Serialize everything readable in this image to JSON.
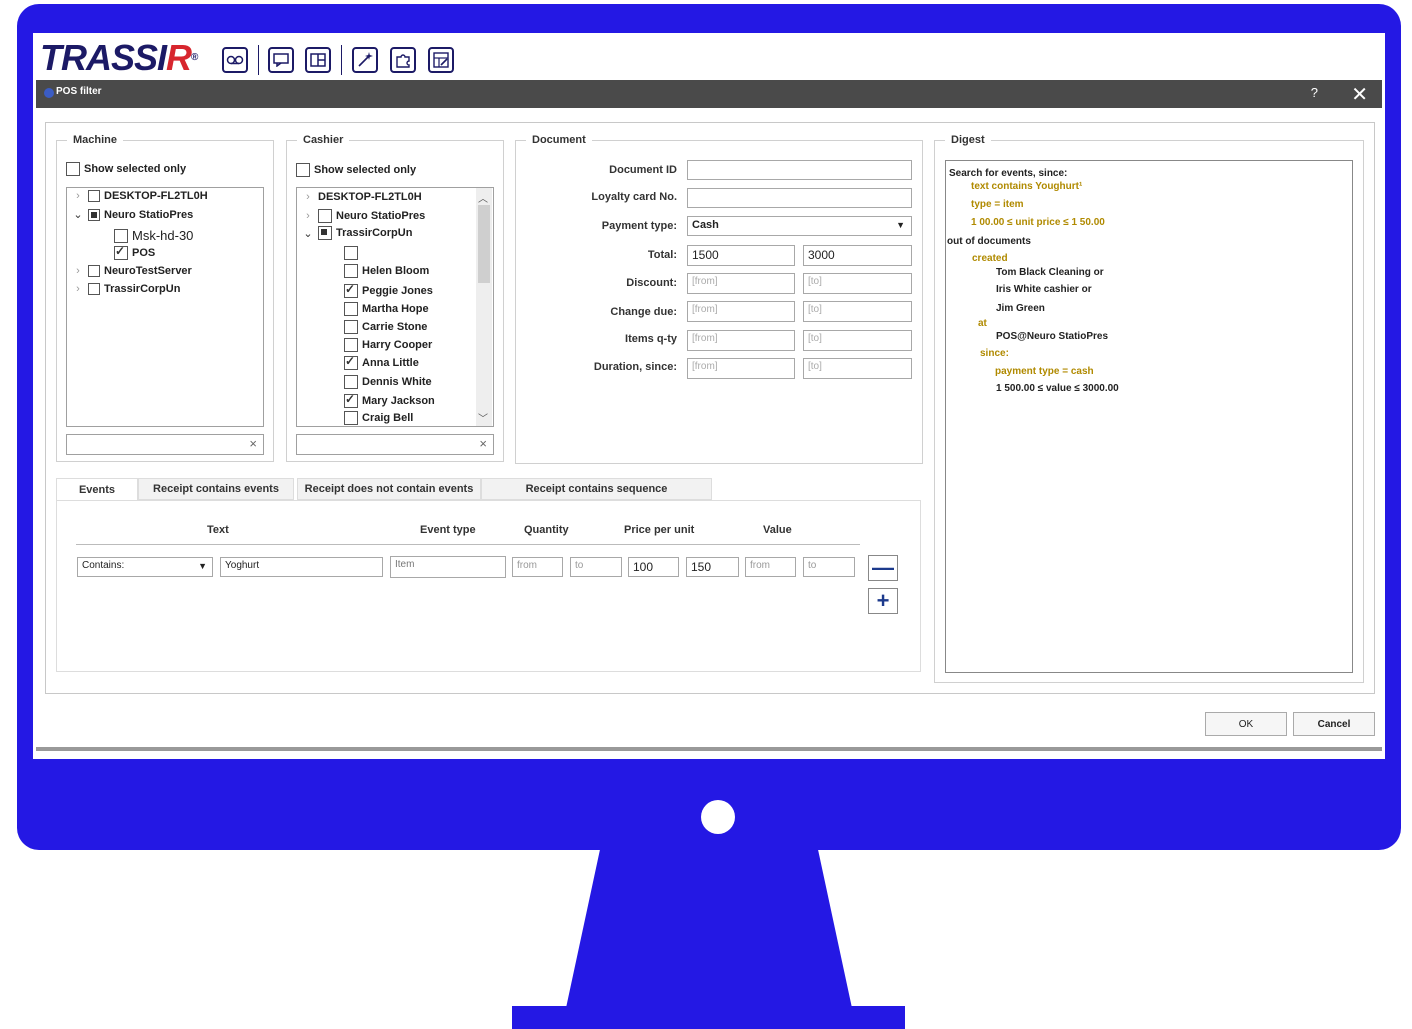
{
  "app": {
    "logo_main": "TRASSI",
    "logo_r": "R",
    "logo_mark": "®",
    "window_title": "POS filter",
    "help": "?",
    "close": "✕",
    "toolbar_icons": [
      "voicemail-icon",
      "chat-icon",
      "layout-icon",
      "magic-wand-icon",
      "puzzle-icon",
      "image-edit-icon"
    ]
  },
  "machine": {
    "title": "Machine",
    "show_selected_label": "Show selected only",
    "items": [
      {
        "label": "DESKTOP-FL2TL0H",
        "state": "unchecked",
        "expanded": false
      },
      {
        "label": "Neuro StatioPres",
        "state": "partial",
        "expanded": true
      },
      {
        "label": "Msk-hd-30",
        "state": "unchecked"
      },
      {
        "label": "POS",
        "state": "checked"
      },
      {
        "label": "NeuroTestServer",
        "state": "unchecked",
        "expanded": false
      },
      {
        "label": "TrassirCorpUn",
        "state": "unchecked",
        "expanded": false
      }
    ],
    "search_value": ""
  },
  "cashier": {
    "title": "Cashier",
    "show_selected_label": "Show selected only",
    "items": [
      {
        "label": "DESKTOP-FL2TL0H"
      },
      {
        "label": "Neuro StatioPres",
        "state": "unchecked"
      },
      {
        "label": "TrassirCorpUn",
        "state": "partial"
      },
      {
        "label": "",
        "state": "unchecked"
      },
      {
        "label": "Helen Bloom",
        "state": "unchecked"
      },
      {
        "label": "Peggie Jones",
        "state": "checked"
      },
      {
        "label": "Martha Hope",
        "state": "unchecked"
      },
      {
        "label": "Carrie Stone",
        "state": "unchecked"
      },
      {
        "label": "Harry Cooper",
        "state": "unchecked"
      },
      {
        "label": "Anna Little",
        "state": "checked"
      },
      {
        "label": "Dennis White",
        "state": "unchecked"
      },
      {
        "label": "Mary Jackson",
        "state": "checked"
      },
      {
        "label": "Craig Bell",
        "state": "unchecked"
      }
    ],
    "search_value": ""
  },
  "document": {
    "title": "Document",
    "document_id_label": "Document ID",
    "document_id_value": "",
    "loyalty_label": "Loyalty card No.",
    "loyalty_value": "",
    "payment_label": "Payment type:",
    "payment_value": "Cash",
    "total_label": "Total:",
    "total_from": "1500",
    "total_to": "3000",
    "discount_label": "Discount:",
    "change_label": "Change due:",
    "items_label": "Items q-ty",
    "duration_label": "Duration, since:",
    "from_placeholder": "[from]",
    "to_placeholder": "[to]"
  },
  "digest": {
    "title": "Digest",
    "lines": [
      "Search for events, since:",
      "text contains Youghurt¹",
      "type = item",
      "1 00.00 ≤ unit price ≤ 1 50.00",
      "out of documents",
      "created",
      "Tom Black Cleaning or",
      "Iris White cashier or",
      "Jim Green",
      "at",
      "POS@Neuro StatioPres",
      "since:",
      "payment type = cash",
      "1 500.00 ≤ value ≤ 3000.00"
    ]
  },
  "tabs": [
    "Events",
    "Receipt contains events",
    "Receipt does not contain events",
    "Receipt contains sequence"
  ],
  "events": {
    "col_text": "Text",
    "col_event_type": "Event type",
    "col_quantity": "Quantity",
    "col_price": "Price per unit",
    "col_value": "Value",
    "row": {
      "match": "Contains:",
      "text": "Yoghurt",
      "event_type": "Item",
      "qty_from": "from",
      "qty_to": "to",
      "price_from": "100",
      "price_to": "150",
      "value_from": "from",
      "value_to": "to"
    },
    "minus": "—",
    "plus": "+"
  },
  "footer": {
    "ok": "OK",
    "cancel": "Cancel"
  }
}
